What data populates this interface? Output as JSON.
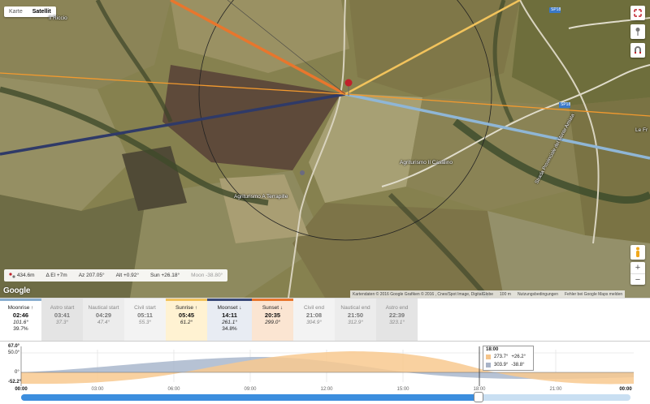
{
  "map": {
    "type_tabs": [
      {
        "label": "Karte",
        "active": false
      },
      {
        "label": "Satellit",
        "active": true
      }
    ],
    "places": {
      "il_riccio": "Il Riccio",
      "agriturismo_casalino": "Agriturismo Il Casalino",
      "agriturismo_terrapille": "Agriturismo A Terrapille",
      "road_montamiata": "Strada Provinciale del Monte Amiata",
      "sp18_a": "SP18",
      "sp18_b": "SP18",
      "le_fr": "Le Fr"
    },
    "info": {
      "elevation": "434.6m",
      "delta_el": "Δ El  +7m",
      "azimuth": "Az 207.05°",
      "altitude": "Alt +0.92°",
      "sun": "Sun +26.18°",
      "moon": "Moon -38.80°"
    },
    "logo": "Google",
    "attribution": {
      "data": "Kartendaten © 2016 Google Grafiken © 2016 , Cnes/Spot Image, DigitalGlobe",
      "scale": "100 m",
      "terms": "Nutzungsbedingungen",
      "report": "Fehler bei Google Maps melden"
    },
    "colors": {
      "sunrise": "#f2a33a",
      "sunset": "#e8762d",
      "moonrise": "#3a4a78",
      "moonset": "#8fb6d6",
      "current": "#ff9933"
    }
  },
  "events": [
    {
      "name": "Moonrise",
      "arrow": "↑",
      "time": "02:46",
      "az": "101.6°",
      "extra": "39.7%",
      "highlight": true,
      "bar": "#8aaed0"
    },
    {
      "name": "Astro start",
      "time": "03:41",
      "az": "37.3°",
      "highlight": false
    },
    {
      "name": "Nautical start",
      "time": "04:29",
      "az": "47.4°",
      "highlight": false
    },
    {
      "name": "Civil start",
      "time": "05:11",
      "az": "55.3°",
      "highlight": false
    },
    {
      "name": "Sunrise",
      "arrow": "↑",
      "time": "05:45",
      "az": "61.2°",
      "highlight": true,
      "bar": "#f2c35c"
    },
    {
      "name": "Moonset",
      "arrow": "↓",
      "time": "14:11",
      "az": "261.1°",
      "extra": "34.8%",
      "highlight": true,
      "bar": "#3a4a78"
    },
    {
      "name": "Sunset",
      "arrow": "↓",
      "time": "20:35",
      "az": "299.0°",
      "highlight": true,
      "bar": "#e8762d"
    },
    {
      "name": "Civil end",
      "time": "21:08",
      "az": "304.9°",
      "highlight": false
    },
    {
      "name": "Nautical end",
      "time": "21:50",
      "az": "312.9°",
      "highlight": false
    },
    {
      "name": "Astro end",
      "time": "22:39",
      "az": "323.1°",
      "highlight": false
    }
  ],
  "timeline": {
    "y_labels": {
      "top": "67.0°",
      "mid": "50.0°",
      "zero": "0°",
      "min": "-52.2°"
    },
    "ticks": [
      "00:00",
      "03:00",
      "06:00",
      "09:00",
      "12:00",
      "15:00",
      "18:00",
      "21:00",
      "00:00"
    ],
    "current_time": "18:00",
    "current_fraction": 0.75,
    "tooltip": {
      "time": "18:00",
      "rows": [
        {
          "az": "273.7°",
          "alt": "+26.2°",
          "color": "#f5c48a"
        },
        {
          "az": "303.9°",
          "alt": "-38.8°",
          "color": "#a8b3c7"
        }
      ]
    },
    "colors": {
      "sun_fill": "#f8c98f",
      "moon_fill": "#a9b7cc",
      "slider": "#3c8ede"
    }
  }
}
